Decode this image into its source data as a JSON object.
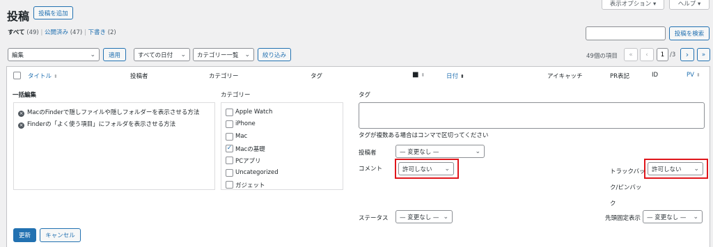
{
  "header": {
    "title": "投稿",
    "add_new_label": "投稿を追加",
    "screen_options_label": "表示オプション ▾",
    "help_label": "ヘルプ ▾"
  },
  "filters": {
    "all_label": "すべて",
    "all_count": "(49)",
    "published_label": "公開済み",
    "published_count": "(47)",
    "draft_label": "下書き",
    "draft_count": "(2)",
    "sep1": "|",
    "sep2": "|"
  },
  "search": {
    "value": "",
    "button_label": "投稿を検索"
  },
  "toolbar": {
    "bulk_action": "編集",
    "apply_label": "適用",
    "date_filter": "すべての日付",
    "category_filter": "カテゴリー一覧",
    "filter_label": "絞り込み",
    "item_count": "49個の項目",
    "first_page": "«",
    "prev_page": "‹",
    "current_page": "1",
    "total_pages": "/3",
    "next_page": "›",
    "last_page": "»"
  },
  "columns": {
    "title": "タイトル",
    "author": "投稿者",
    "categories": "カテゴリー",
    "tags": "タグ",
    "date": "日付",
    "eyecatch": "アイキャッチ",
    "pr": "PR表記",
    "id": "ID",
    "pv": "PV"
  },
  "bulk_edit": {
    "heading": "一括編集",
    "posts": [
      "MacのFinderで隠しファイルや隠しフォルダーを表示させる方法",
      "Finderの「よく使う項目」にフォルダを表示させる方法"
    ],
    "categories_label": "カテゴリー",
    "categories": [
      {
        "name": "Apple Watch",
        "checked": false
      },
      {
        "name": "iPhone",
        "checked": false
      },
      {
        "name": "Mac",
        "checked": false
      },
      {
        "name": "Macの基礎",
        "checked": true
      },
      {
        "name": "PCアプリ",
        "checked": false
      },
      {
        "name": "Uncategorized",
        "checked": false
      },
      {
        "name": "ガジェット",
        "checked": false
      }
    ],
    "tags_label": "タグ",
    "tags_hint": "タグが複数ある場合はコンマで区切ってください",
    "author_label": "投稿者",
    "author_value": "— 変更なし —",
    "comment_label": "コメント",
    "comment_value": "許可しない",
    "trackback_label_1": "トラックバッ",
    "trackback_label_2": "ク/ピンバッ",
    "trackback_label_3": "ク",
    "trackback_value": "許可しない",
    "status_label": "ステータス",
    "status_value": "— 変更なし —",
    "sticky_label": "先頭固定表示",
    "sticky_value": "— 変更なし —",
    "update_label": "更新",
    "cancel_label": "キャンセル"
  },
  "colors": {
    "accent": "#2271b1",
    "highlight": "#e0161b"
  }
}
